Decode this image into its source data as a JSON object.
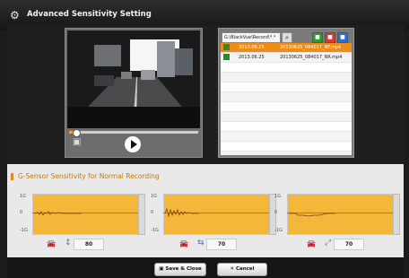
{
  "window": {
    "title": "Advanced Sensitivity Setting"
  },
  "player": {
    "progress": 0.05
  },
  "filelist": {
    "path": "G:\\BlackVue\\Record\\*.*",
    "files": [
      {
        "date": "2013.06.25",
        "name": "20130625_084017_NF.mp4",
        "selected": true
      },
      {
        "date": "2013.06.25",
        "name": "20130625_084017_NR.mp4",
        "selected": false
      }
    ]
  },
  "section": {
    "title": "G-Sensor Sensitivity for Normal Recording"
  },
  "graphs": [
    {
      "axis_top": "1G",
      "axis_mid": "0",
      "axis_bottom": "-1G",
      "value": "80"
    },
    {
      "axis_top": "1G",
      "axis_mid": "0",
      "axis_bottom": "-1G",
      "value": "70"
    },
    {
      "axis_top": "1G",
      "axis_mid": "0",
      "axis_bottom": "-1G",
      "value": "70"
    }
  ],
  "buttons": {
    "save": "Save & Close",
    "cancel": "Cancel"
  },
  "colors": {
    "accent": "#f08c16",
    "graph_bg": "#f3b83a",
    "section_title": "#c07a10"
  }
}
